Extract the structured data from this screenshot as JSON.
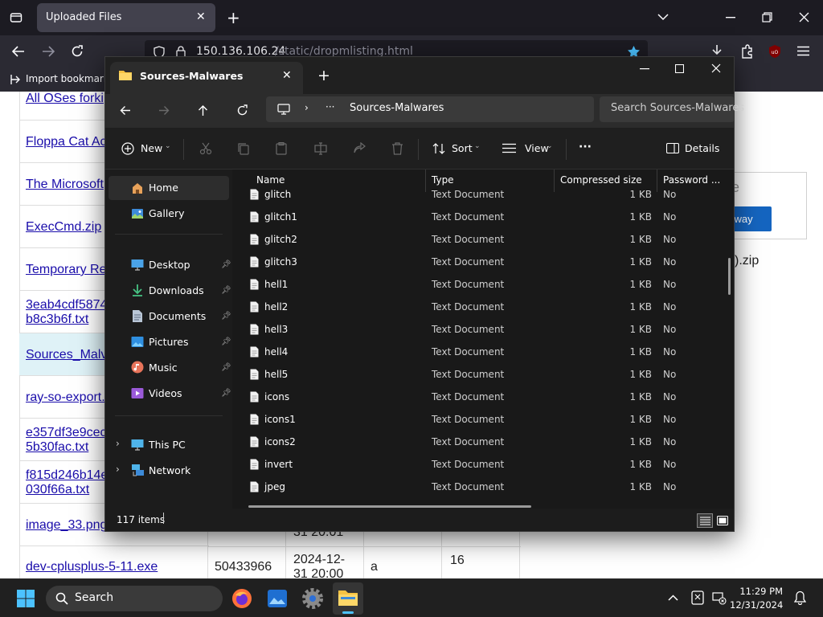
{
  "browser": {
    "tab_title": "Uploaded Files",
    "url_host": "150.136.106.24",
    "url_path": "/static/dropmlisting.html",
    "bookmarks_item": "Import bookmarks"
  },
  "webpage": {
    "rows": [
      {
        "text": "All OSes forki"
      },
      {
        "text": "Floppa Cat Ac"
      },
      {
        "text": "The Microsoft"
      },
      {
        "text": "ExecCmd.zip"
      },
      {
        "text": "Temporary Re"
      },
      {
        "line1": "3eab4cdf5874",
        "line2": "b8c3b6f.txt"
      },
      {
        "text": "Sources_Malv"
      },
      {
        "text": "ray-so-export."
      },
      {
        "line1": "e357df3e9cec",
        "line2": "5b30fac.txt"
      },
      {
        "line1": "f815d246b14e",
        "line2": "030f66a.txt"
      },
      {
        "text": "image_33.png"
      },
      {
        "text": "dev-cplusplus-5-11.exe"
      }
    ],
    "partial_date": "31 20:01",
    "last_row": {
      "size": "50433966",
      "date_line1": "2024-12-",
      "date_line2": "31 20:00",
      "col4": "a",
      "col5": "16"
    },
    "dialog_partial_title": "le",
    "dialog_button_partial": "yway",
    "zip_partial": ").zip"
  },
  "explorer": {
    "tab_title": "Sources-Malwares",
    "breadcrumb_more": "···",
    "breadcrumb_folder": "Sources-Malwares",
    "search_placeholder": "Search Sources-Malwares",
    "cmd": {
      "new": "New",
      "sort": "Sort",
      "view": "View",
      "more": "···",
      "details": "Details"
    },
    "nav": [
      {
        "label": "Home",
        "icon": "home-icon",
        "selected": true
      },
      {
        "label": "Gallery",
        "icon": "gallery-icon"
      },
      {
        "label": "Desktop",
        "icon": "desktop-icon",
        "pinned": true
      },
      {
        "label": "Downloads",
        "icon": "downloads-icon",
        "pinned": true
      },
      {
        "label": "Documents",
        "icon": "documents-icon",
        "pinned": true
      },
      {
        "label": "Pictures",
        "icon": "pictures-icon",
        "pinned": true
      },
      {
        "label": "Music",
        "icon": "music-icon",
        "pinned": true
      },
      {
        "label": "Videos",
        "icon": "videos-icon",
        "pinned": true
      },
      {
        "label": "This PC",
        "icon": "this-pc-icon"
      },
      {
        "label": "Network",
        "icon": "network-icon"
      }
    ],
    "columns": {
      "name": "Name",
      "type": "Type",
      "compressed_size": "Compressed size",
      "password": "Password ..."
    },
    "files": [
      {
        "name": "glitch",
        "type": "Text Document",
        "size": "1 KB",
        "password": "No"
      },
      {
        "name": "glitch1",
        "type": "Text Document",
        "size": "1 KB",
        "password": "No"
      },
      {
        "name": "glitch2",
        "type": "Text Document",
        "size": "1 KB",
        "password": "No"
      },
      {
        "name": "glitch3",
        "type": "Text Document",
        "size": "1 KB",
        "password": "No"
      },
      {
        "name": "hell1",
        "type": "Text Document",
        "size": "1 KB",
        "password": "No"
      },
      {
        "name": "hell2",
        "type": "Text Document",
        "size": "1 KB",
        "password": "No"
      },
      {
        "name": "hell3",
        "type": "Text Document",
        "size": "1 KB",
        "password": "No"
      },
      {
        "name": "hell4",
        "type": "Text Document",
        "size": "1 KB",
        "password": "No"
      },
      {
        "name": "hell5",
        "type": "Text Document",
        "size": "1 KB",
        "password": "No"
      },
      {
        "name": "icons",
        "type": "Text Document",
        "size": "1 KB",
        "password": "No"
      },
      {
        "name": "icons1",
        "type": "Text Document",
        "size": "1 KB",
        "password": "No"
      },
      {
        "name": "icons2",
        "type": "Text Document",
        "size": "1 KB",
        "password": "No"
      },
      {
        "name": "invert",
        "type": "Text Document",
        "size": "1 KB",
        "password": "No"
      },
      {
        "name": "jpeg",
        "type": "Text Document",
        "size": "1 KB",
        "password": "No"
      }
    ],
    "status_count": "117 items"
  },
  "taskbar": {
    "search_label": "Search",
    "time": "11:29 PM",
    "date": "12/31/2024"
  },
  "colors": {
    "accent_blue": "#4cc2ff",
    "folder_yellow": "#f6c343",
    "link_blue": "#1a0dab"
  }
}
